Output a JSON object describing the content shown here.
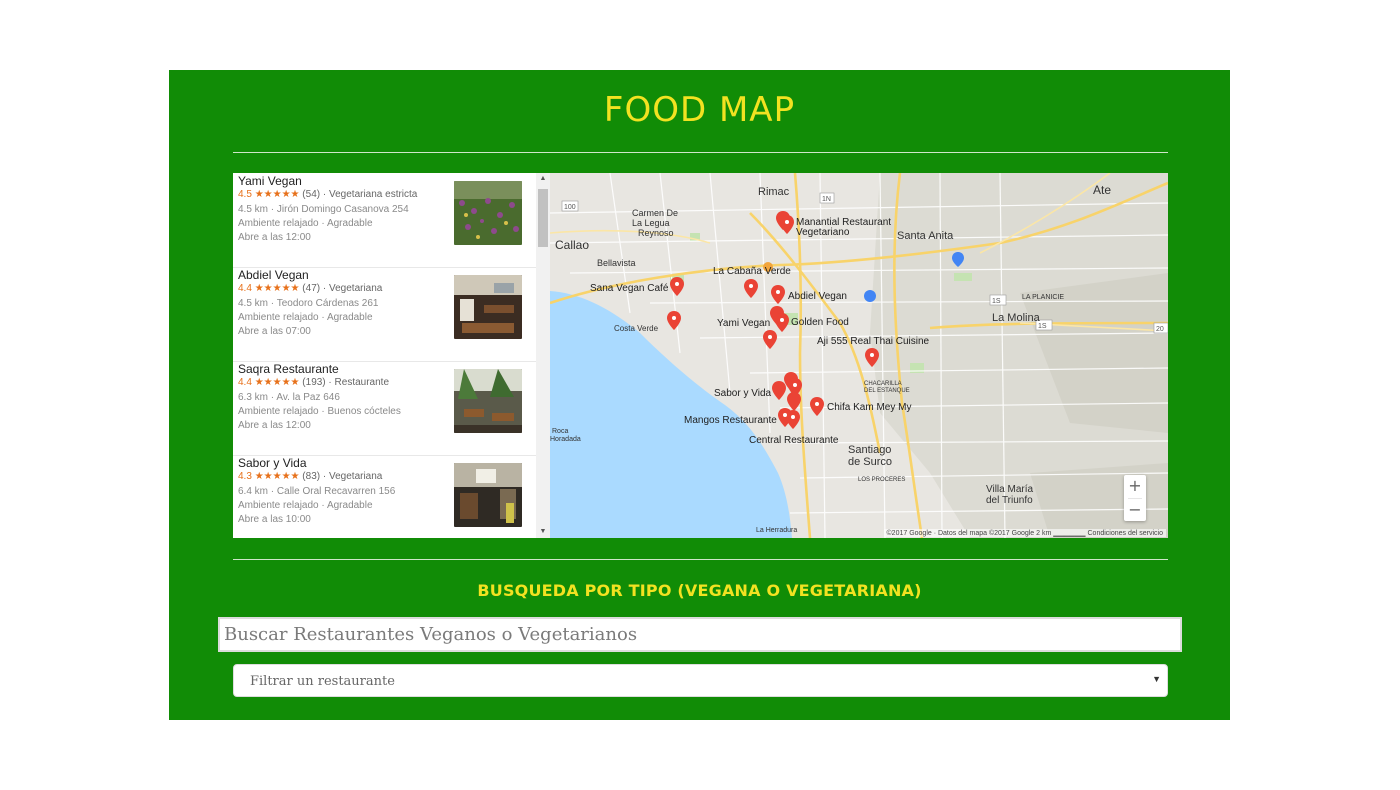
{
  "header": {
    "title": "FOOD MAP"
  },
  "results": [
    {
      "name": "Yami Vegan",
      "rating": "4.5",
      "stars": "★★★★★",
      "count": "(54)",
      "type": "Vegetariana estricta",
      "distance": "4.5 km",
      "address": "Jirón Domingo Casanova 254",
      "ambience": "Ambiente relajado · Agradable",
      "hours": "Abre a las 12:00"
    },
    {
      "name": "Abdiel Vegan",
      "rating": "4.4",
      "stars": "★★★★★",
      "count": "(47)",
      "type": "Vegetariana",
      "distance": "4.5 km",
      "address": "Teodoro Cárdenas 261",
      "ambience": "Ambiente relajado · Agradable",
      "hours": "Abre a las 07:00"
    },
    {
      "name": "Saqra Restaurante",
      "rating": "4.4",
      "stars": "★★★★★",
      "count": "(193)",
      "type": "Restaurante",
      "distance": "6.3 km",
      "address": "Av. la Paz 646",
      "ambience": "Ambiente relajado · Buenos cócteles",
      "hours": "Abre a las 12:00"
    },
    {
      "name": "Sabor y Vida",
      "rating": "4.3",
      "stars": "★★★★★",
      "count": "(83)",
      "type": "Vegetariana",
      "distance": "6.4 km",
      "address": "Calle Oral Recavarren 156",
      "ambience": "Ambiente relajado · Agradable",
      "hours": "Abre a las 10:00"
    }
  ],
  "map": {
    "places": [
      "Rimac",
      "Ate",
      "Carmen De",
      "La Legua",
      "Reynoso",
      "Callao",
      "Bellavista",
      "Santa Anita",
      "La Molina",
      "LA PLANICIE",
      "Costa Verde",
      "CHACARILLA",
      "DEL ESTANQUE",
      "Santiago",
      "de Surco",
      "LOS PROCERES",
      "Villa María",
      "del Triunfo",
      "La Herradura",
      "Roca",
      "Horadada"
    ],
    "restaurants": [
      "Manantial Restaurant",
      "Vegetariano",
      "La Cabaña Verde",
      "Sana Vegan Café",
      "Abdiel Vegan",
      "Yami Vegan",
      "Golden Food",
      "Aji 555 Real Thai Cuisine",
      "Sabor y Vida",
      "Chifa Kam Mey My",
      "Mangos Restaurante",
      "Central Restaurante"
    ],
    "road_numbers": [
      "100",
      "1N",
      "1S",
      "1S",
      "20"
    ],
    "zoom_in": "+",
    "zoom_out": "−",
    "attribution": "©2017 Google · Datos del mapa ©2017 Google   2 km ▁▁▁▁▁▁   Condiciones del servicio"
  },
  "search": {
    "title": "BUSQUEDA POR TIPO (VEGANA O VEGETARIANA)",
    "placeholder": "Buscar Restaurantes Veganos o Vegetarianos"
  },
  "filter": {
    "selected": "Filtrar un restaurante",
    "caret": "▼"
  },
  "list_scroll": {
    "up": "▲",
    "down": "▼"
  },
  "colors": {
    "background": "#118c06",
    "title": "#f2e221",
    "stars": "#e7711b",
    "pin": "#ea4335",
    "water": "#aadaff"
  }
}
